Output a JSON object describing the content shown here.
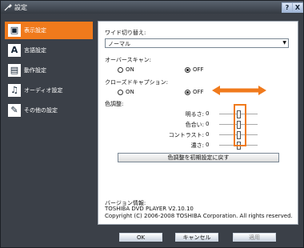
{
  "window": {
    "title": "設定",
    "help_label": "?",
    "close_label": "X"
  },
  "sidebar": {
    "items": [
      {
        "label": "表示設定",
        "icon": "display-icon",
        "glyph": "▣",
        "active": true
      },
      {
        "label": "言語設定",
        "icon": "letter-a-icon",
        "glyph": "A",
        "active": false
      },
      {
        "label": "動作設定",
        "icon": "chapter-icon",
        "glyph": "▤",
        "active": false
      },
      {
        "label": "オーディオ設定",
        "icon": "music-note-icon",
        "glyph": "♫",
        "active": false
      },
      {
        "label": "その他の設定",
        "icon": "wrench-icon",
        "glyph": "✎",
        "active": false
      }
    ]
  },
  "panel": {
    "wide_label": "ワイド切り替え:",
    "wide_value": "ノーマル",
    "overscan_label": "オーバースキャン:",
    "overscan_on": "ON",
    "overscan_off": "OFF",
    "overscan_selected": "OFF",
    "cc_label": "クローズドキャプション:",
    "cc_on": "ON",
    "cc_off": "OFF",
    "cc_selected": "OFF",
    "color_label": "色調整:",
    "sliders": [
      {
        "label": "明るさ:",
        "value": "0",
        "level": 0.5
      },
      {
        "label": "色合い:",
        "value": "0",
        "level": 0.5
      },
      {
        "label": "コントラスト:",
        "value": "0",
        "level": 0.5
      },
      {
        "label": "濃さ:",
        "value": "0",
        "level": 0.5
      }
    ],
    "reset_label": "色調整を初期設定に戻す",
    "version_label": "バージョン情報:",
    "version_line": "TOSHIBA DVD PLAYER V2.10.10",
    "copyright_line": "Copyright (C) 2006-2008 TOSHIBA Corporation. All rights reserved."
  },
  "buttons": {
    "ok": "OK",
    "cancel": "キャンセル",
    "apply": "適用"
  },
  "colors": {
    "accent": "#f07a1c",
    "frame": "#3b4048",
    "panel": "#ffffff"
  }
}
